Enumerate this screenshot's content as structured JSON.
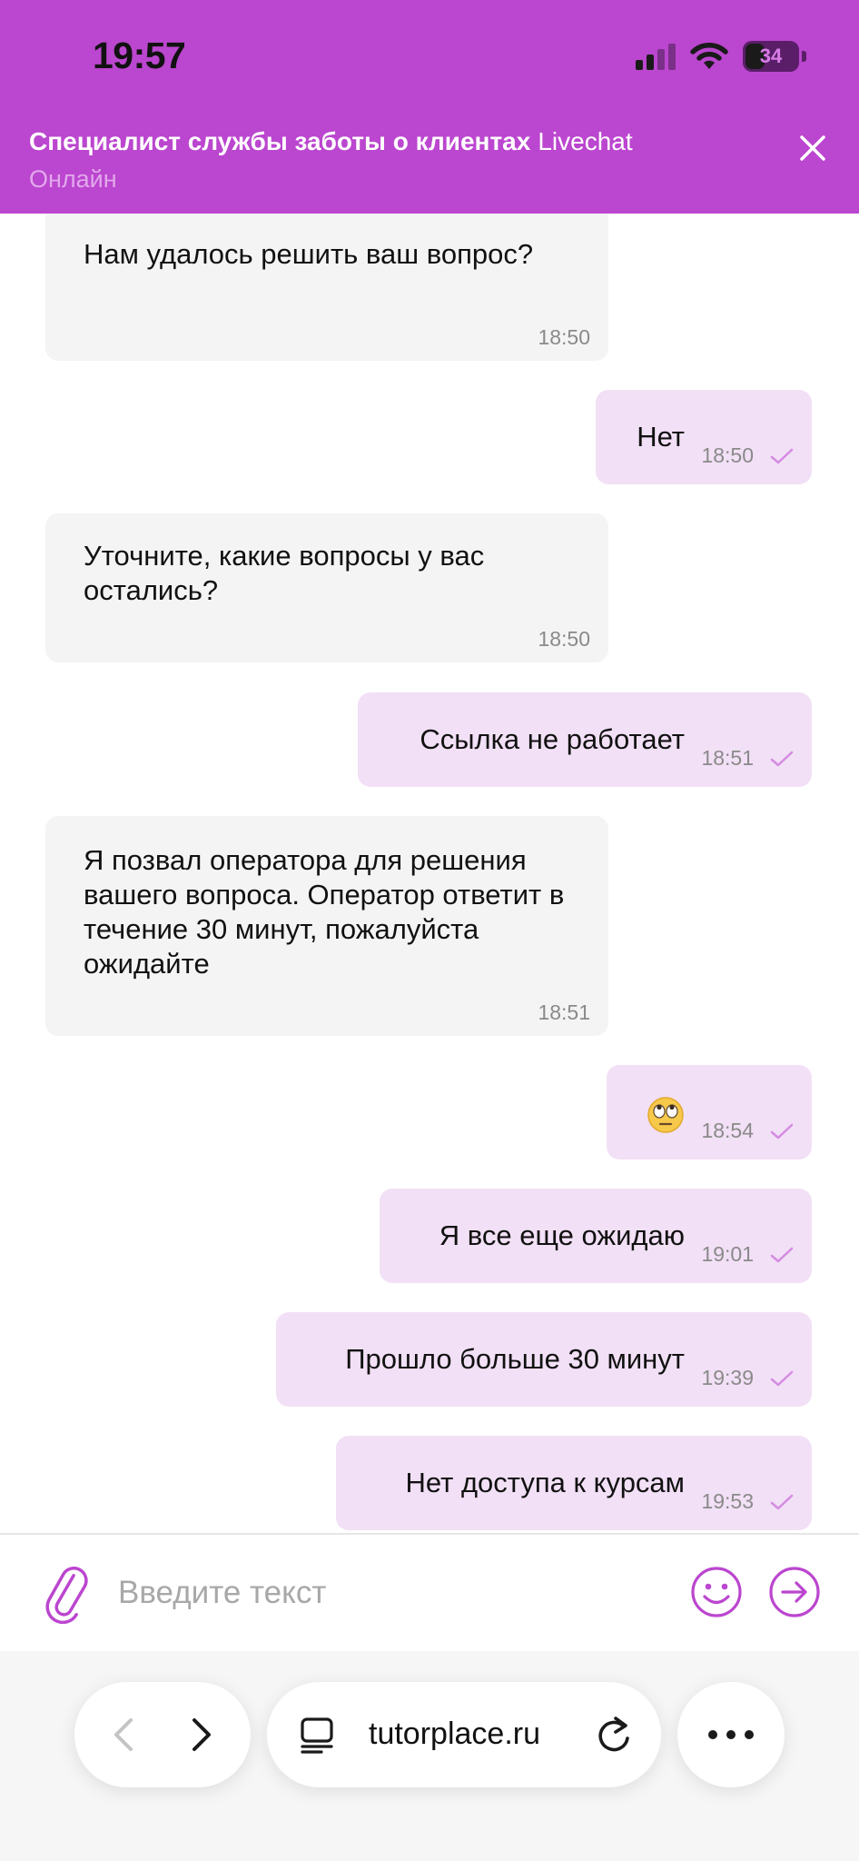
{
  "status_bar": {
    "time": "19:57",
    "battery": "34"
  },
  "chat_header": {
    "agent_title": "Специалист службы заботы о клиентах",
    "service_name": "Livechat",
    "status": "Онлайн",
    "close_icon": "close-icon"
  },
  "messages": [
    {
      "direction": "in",
      "text": "Нам удалось решить ваш вопрос?",
      "time": "18:50"
    },
    {
      "direction": "out",
      "text": "Нет",
      "time": "18:50"
    },
    {
      "direction": "in",
      "text": "Уточните, какие вопросы у вас остались?",
      "time": "18:50"
    },
    {
      "direction": "out",
      "text": "Ссылка не работает",
      "time": "18:51"
    },
    {
      "direction": "in",
      "text": "Я позвал оператора для решения вашего вопроса. Оператор ответит в течение 30 минут, пожалуйста ожидайте",
      "time": "18:51"
    },
    {
      "direction": "out",
      "text": "",
      "emoji": "face-with-rolling-eyes",
      "time": "18:54"
    },
    {
      "direction": "out",
      "text": "Я все еще ожидаю",
      "time": "19:01"
    },
    {
      "direction": "out",
      "text": "Прошло больше 30 минут",
      "time": "19:39"
    },
    {
      "direction": "out",
      "text": "Нет доступа к курсам",
      "time": "19:53"
    }
  ],
  "composer": {
    "placeholder": "Введите текст",
    "value": ""
  },
  "browser": {
    "url": "tutorplace.ru"
  },
  "colors": {
    "accent": "#bb46cf",
    "incoming_bubble": "#f4f4f4",
    "outgoing_bubble": "#f2e0f6"
  }
}
